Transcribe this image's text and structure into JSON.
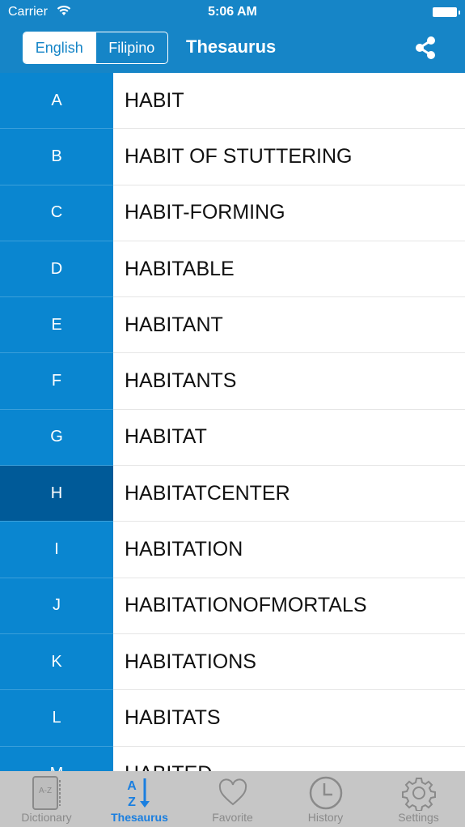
{
  "status_bar": {
    "carrier": "Carrier",
    "time": "5:06 AM"
  },
  "header": {
    "segments": [
      {
        "label": "English",
        "selected": true
      },
      {
        "label": "Filipino",
        "selected": false
      }
    ],
    "title": "Thesaurus",
    "share_icon": "share-icon"
  },
  "list": {
    "selected_letter": "H",
    "rows": [
      {
        "letter": "A",
        "word": "HABIT"
      },
      {
        "letter": "B",
        "word": "HABIT OF STUTTERING"
      },
      {
        "letter": "C",
        "word": "HABIT-FORMING"
      },
      {
        "letter": "D",
        "word": "HABITABLE"
      },
      {
        "letter": "E",
        "word": "HABITANT"
      },
      {
        "letter": "F",
        "word": "HABITANTS"
      },
      {
        "letter": "G",
        "word": "HABITAT"
      },
      {
        "letter": "H",
        "word": "HABITATCENTER"
      },
      {
        "letter": "I",
        "word": "HABITATION"
      },
      {
        "letter": "J",
        "word": "HABITATIONOFMORTALS"
      },
      {
        "letter": "K",
        "word": "HABITATIONS"
      },
      {
        "letter": "L",
        "word": "HABITATS"
      },
      {
        "letter": "M",
        "word": "HABITED"
      }
    ]
  },
  "tabbar": {
    "accent": "#1a7fe0",
    "tabs": [
      {
        "label": "Dictionary",
        "icon": "book-az-icon",
        "active": false
      },
      {
        "label": "Thesaurus",
        "icon": "az-sort-icon",
        "active": true
      },
      {
        "label": "Favorite",
        "icon": "heart-icon",
        "active": false
      },
      {
        "label": "History",
        "icon": "clock-icon",
        "active": false
      },
      {
        "label": "Settings",
        "icon": "gear-icon",
        "active": false
      }
    ]
  }
}
